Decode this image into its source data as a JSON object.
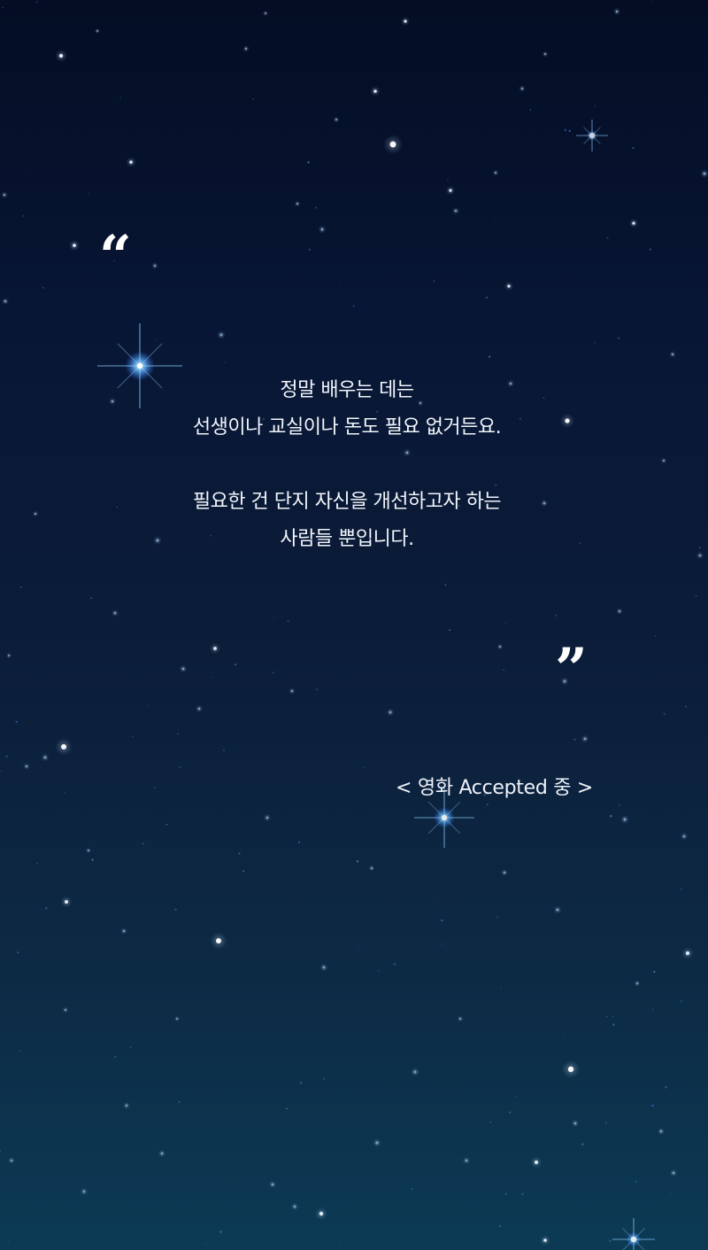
{
  "quote": {
    "open_mark": "“",
    "close_mark": "”",
    "lines": [
      "정말 배우는 데는",
      "선생이나 교실이나 돈도 필요 없거든요.",
      "필요한 건 단지 자신을 개선하고자 하는",
      "사람들 뿐입니다."
    ],
    "source": "< 영화 Accepted 중 >"
  },
  "colors": {
    "sky_top": "#040d24",
    "sky_bottom": "#0c3a55",
    "text": "#ffffff",
    "star_glow": "#4aa3ff"
  }
}
